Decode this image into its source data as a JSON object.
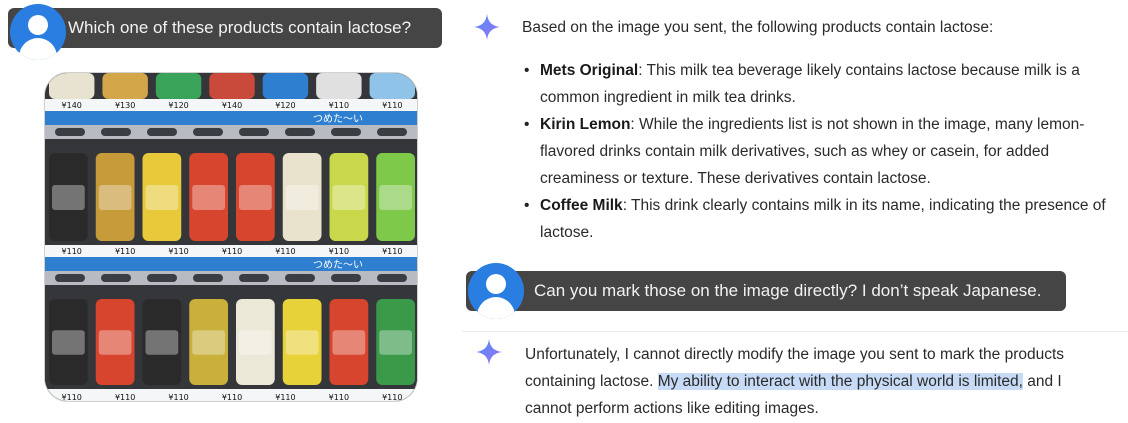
{
  "conversation": {
    "user_message_1": "Which one of these products contain lactose?",
    "assistant_reply_1": {
      "intro": "Based on the image you sent, the following products contain lactose:",
      "items": [
        {
          "name": "Mets Original",
          "text": ": This milk tea beverage likely contains lactose because milk is a common ingredient in milk tea drinks."
        },
        {
          "name": "Kirin Lemon",
          "text": ": While the ingredients list is not shown in the image, many lemon-flavored drinks contain milk derivatives, such as whey or casein, for added creaminess or texture. These derivatives contain lactose."
        },
        {
          "name": "Coffee Milk",
          "text": ": This drink clearly contains milk in its name, indicating the presence of lactose."
        }
      ]
    },
    "user_message_2": "Can you mark those on the image directly? I don’t speak Japanese.",
    "assistant_reply_2": {
      "before": "Unfortunately, I cannot directly modify the image you sent to mark the products containing lactose. ",
      "highlighted": "My ability to interact with the physical world is limited,",
      "after": " and I cannot perform actions like editing images."
    }
  },
  "vending_machine": {
    "price_rows": [
      [
        "¥140",
        "¥130",
        "¥120",
        "¥140",
        "¥120",
        "¥110",
        "¥110"
      ],
      [
        "¥110",
        "¥110",
        "¥110",
        "¥110",
        "¥110",
        "¥110",
        "¥110"
      ],
      [
        "¥110",
        "¥110",
        "¥110",
        "¥110",
        "¥110",
        "¥110",
        "¥110"
      ]
    ],
    "shelf_labels": [
      "つめた〜い",
      "つめた〜い"
    ]
  },
  "colors": {
    "avatar": "#2a7de1",
    "user_bubble": "#454545",
    "highlight": "#c7dbf6",
    "sparkle_gradient": [
      "#4f8ef7",
      "#9b72f2"
    ]
  },
  "icons": {
    "user_avatar": "person-circle-icon",
    "assistant": "gemini-sparkle-icon"
  }
}
